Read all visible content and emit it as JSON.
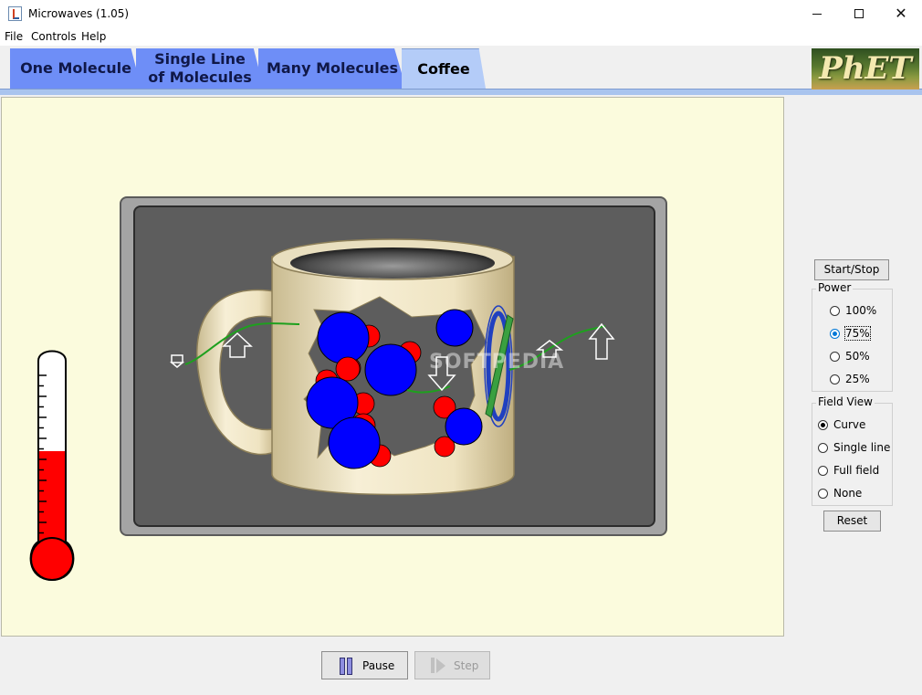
{
  "window": {
    "title": "Microwaves (1.05)",
    "controls": [
      "minimize",
      "maximize",
      "close"
    ],
    "close_glyph": "✕"
  },
  "menu": [
    "File",
    "Controls",
    "Help"
  ],
  "tabs": [
    {
      "label": "One Molecule",
      "active": false
    },
    {
      "label": "Single Line\nof Molecules",
      "active": false
    },
    {
      "label": "Many Molecules",
      "active": false
    },
    {
      "label": "Coffee",
      "active": true
    }
  ],
  "logo": "PhET",
  "watermark": "SOFTPEDIA",
  "thermometer": {
    "level_fraction": 0.5
  },
  "controls": {
    "start_stop_label": "Start/Stop",
    "power": {
      "title": "Power",
      "options": [
        "100%",
        "75%",
        "50%",
        "25%"
      ],
      "selected": "75%"
    },
    "field_view": {
      "title": "Field View",
      "options": [
        "Curve",
        "Single line",
        "Full field",
        "None"
      ],
      "selected": "Curve"
    },
    "reset_label": "Reset"
  },
  "playback": {
    "pause_label": "Pause",
    "step_label": "Step",
    "step_enabled": false
  },
  "colors": {
    "tab_inactive": "#6e8ef7",
    "tab_active": "#b4ccf8",
    "play_area": "#fbfbdd",
    "oven_window": "#5d5d5d",
    "mug": "#efe4c2",
    "oxygen": "#0000ff",
    "hydrogen": "#ff0000",
    "field_curve": "#1ea01e",
    "thermometer_fluid": "#ff0000"
  }
}
